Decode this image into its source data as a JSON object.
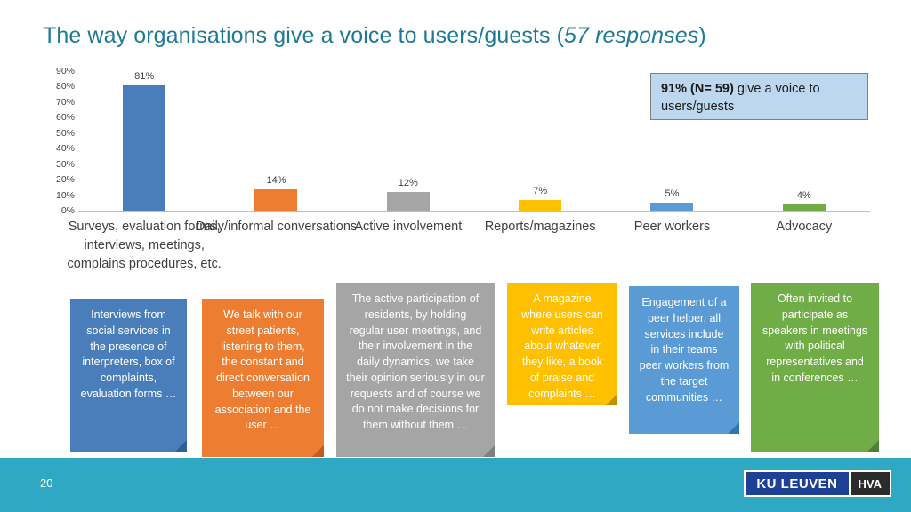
{
  "slide": {
    "title_main": "The way organisations give a voice to users/guests (",
    "title_em": "57 responses",
    "title_end": ")",
    "page_number": "20"
  },
  "callout": {
    "strong": "91% (N= 59)",
    "rest": " give a voice to users/guests"
  },
  "logo": {
    "ku": "KU LEUVEN",
    "hva": "HVA"
  },
  "chart_data": {
    "type": "bar",
    "title": "The way organisations give a voice to users/guests (57 responses)",
    "categories": [
      "Surveys, evaluation forms, interviews, meetings, complains procedures, etc.",
      "Daily/informal conversations",
      "Active involvement",
      "Reports/magazines",
      "Peer workers",
      "Advocacy"
    ],
    "values": [
      81,
      14,
      12,
      7,
      5,
      4
    ],
    "data_labels": [
      "81%",
      "14%",
      "12%",
      "7%",
      "5%",
      "4%"
    ],
    "colors": [
      "#4a7ebb",
      "#ed7d31",
      "#a5a5a5",
      "#ffc000",
      "#5b9bd5",
      "#70ad47"
    ],
    "xlabel": "",
    "ylabel": "",
    "ylim": [
      0,
      90
    ],
    "yticks": [
      "0%",
      "10%",
      "20%",
      "30%",
      "40%",
      "50%",
      "60%",
      "70%",
      "80%",
      "90%"
    ],
    "ytick_values": [
      0,
      10,
      20,
      30,
      40,
      50,
      60,
      70,
      80,
      90
    ],
    "grid": false,
    "legend": "none"
  },
  "notes": [
    {
      "text": "Interviews from social services in the presence of interpreters, box of complaints, evaluation forms …",
      "color": "#4a7ebb",
      "fold": "#2f5f96"
    },
    {
      "text": "We talk with our street patients, listening to them, the constant and direct conversation between our association and the user …",
      "color": "#ed7d31",
      "fold": "#bf5e1d"
    },
    {
      "text": "The active participation of residents, by holding regular user meetings, and their involvement in the daily dynamics, we take their opinion seriously in our requests and of course we do not make decisions for them without them …",
      "color": "#a5a5a5",
      "fold": "#7f7f7f"
    },
    {
      "text": "A magazine where users can write articles about whatever they like, a book of praise and complaints …",
      "color": "#ffc000",
      "fold": "#bf8f00"
    },
    {
      "text": "Engagement of a peer helper, all services include in their teams peer workers from the target communities …",
      "color": "#5b9bd5",
      "fold": "#2e75b6"
    },
    {
      "text": "Often invited to participate as speakers in meetings with political representatives and in conferences …",
      "color": "#70ad47",
      "fold": "#507e32"
    }
  ]
}
